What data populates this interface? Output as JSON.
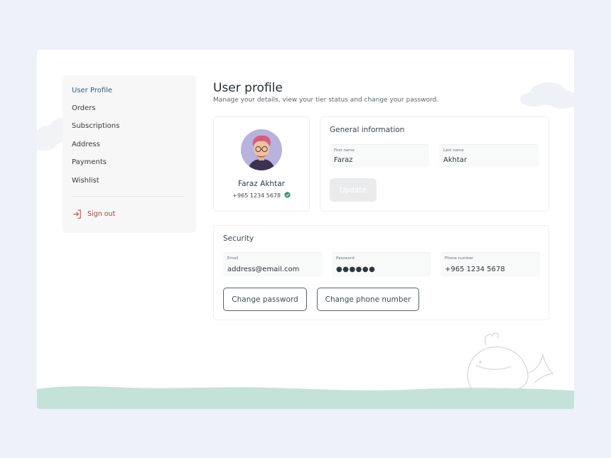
{
  "sidebar": {
    "items": [
      {
        "label": "User Profile",
        "active": true
      },
      {
        "label": "Orders"
      },
      {
        "label": "Subscriptions"
      },
      {
        "label": "Address"
      },
      {
        "label": "Payments"
      },
      {
        "label": "Wishlist"
      }
    ],
    "signout": {
      "label": "Sign out",
      "icon": "sign-out-icon"
    }
  },
  "header": {
    "title": "User profile",
    "subtitle": "Manage your details, view your tier status and change your password."
  },
  "profile": {
    "name": "Faraz Akhtar",
    "phone": "+965 1234 5678",
    "verified_icon": "verified-check-icon"
  },
  "general": {
    "title": "General information",
    "first_name": {
      "label": "First name",
      "value": "Faraz"
    },
    "last_name": {
      "label": "Last name",
      "value": "Akhtar"
    },
    "update_label": "Update"
  },
  "security": {
    "title": "Security",
    "email": {
      "label": "Email",
      "value": "address@email.com"
    },
    "password": {
      "label": "Password",
      "value": "●●●●●●"
    },
    "phone": {
      "label": "Phone number",
      "value": "+965 1234 5678"
    },
    "change_password_label": "Change password",
    "change_phone_label": "Change phone number"
  },
  "colors": {
    "page_bg": "#eef1fa",
    "accent": "#2f5b87",
    "signout": "#a0473c",
    "water": "#c5e2d9",
    "verified": "#3f8f6f"
  }
}
